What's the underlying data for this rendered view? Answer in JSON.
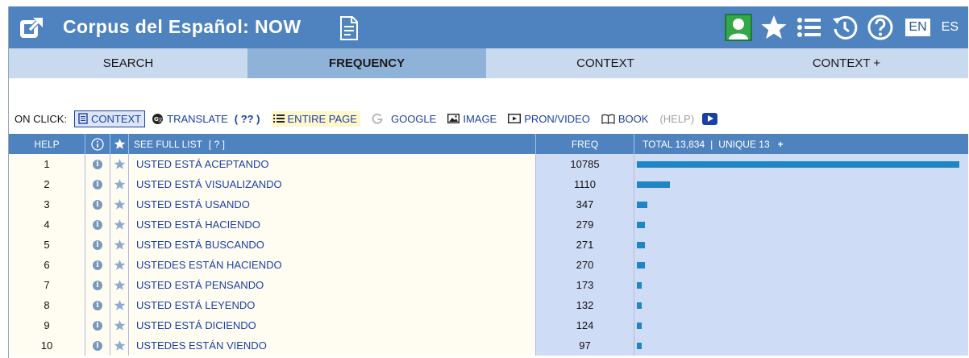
{
  "header": {
    "title": "Corpus del Español: NOW",
    "lang_en": "EN",
    "lang_es": "ES",
    "colors": {
      "header_bg": "#4f83c0",
      "tab_bg": "#c9daee",
      "tab_active": "#8fb2d9",
      "bar": "#1f86c6"
    }
  },
  "tabs": [
    {
      "label": "SEARCH"
    },
    {
      "label": "FREQUENCY"
    },
    {
      "label": "CONTEXT"
    },
    {
      "label": "CONTEXT +"
    }
  ],
  "onclick": {
    "label": "ON CLICK:",
    "context": "CONTEXT",
    "translate": "TRANSLATE",
    "translate_q": "( ?? )",
    "entire_page": "ENTIRE PAGE",
    "google": "GOOGLE",
    "image": "IMAGE",
    "pron_video": "PRON/VIDEO",
    "book": "BOOK",
    "help": "(HELP)"
  },
  "table": {
    "headers": {
      "help": "HELP",
      "see_full_list": "SEE FULL LIST",
      "see_full_list_q": "[ ? ]",
      "freq": "FREQ",
      "total": "TOTAL 13,834",
      "unique": "UNIQUE 13",
      "plus": "+"
    },
    "rows": [
      {
        "num": "1",
        "word": "USTED ESTÁ ACEPTANDO",
        "freq": "10785",
        "bar": 10785
      },
      {
        "num": "2",
        "word": "USTED ESTÁ VISUALIZANDO",
        "freq": "1110",
        "bar": 1110
      },
      {
        "num": "3",
        "word": "USTED ESTÁ USANDO",
        "freq": "347",
        "bar": 347
      },
      {
        "num": "4",
        "word": "USTED ESTÁ HACIENDO",
        "freq": "279",
        "bar": 279
      },
      {
        "num": "5",
        "word": "USTED ESTÁ BUSCANDO",
        "freq": "271",
        "bar": 271
      },
      {
        "num": "6",
        "word": "USTEDES ESTÁN HACIENDO",
        "freq": "270",
        "bar": 270
      },
      {
        "num": "7",
        "word": "USTED ESTÁ PENSANDO",
        "freq": "173",
        "bar": 173
      },
      {
        "num": "8",
        "word": "USTED ESTÁ LEYENDO",
        "freq": "132",
        "bar": 132
      },
      {
        "num": "9",
        "word": "USTED ESTÁ DICIENDO",
        "freq": "124",
        "bar": 124
      },
      {
        "num": "10",
        "word": "USTEDES ESTÁN VIENDO",
        "freq": "97",
        "bar": 97
      }
    ]
  }
}
